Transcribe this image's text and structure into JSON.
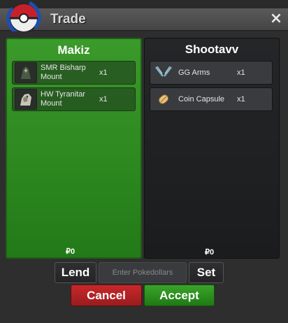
{
  "window": {
    "title": "Trade",
    "close_symbol": "×"
  },
  "icons": {
    "logo": "pokeball-logo-icon",
    "close": "close-icon"
  },
  "colors": {
    "left_panel": "#2e8a22",
    "accent_red": "#b22022",
    "accent_green": "#2a9a1e"
  },
  "left": {
    "player": "Makiz",
    "items": [
      {
        "name": "SMR Bisharp Mount",
        "qty": "x1",
        "icon": "bisharp-mount-icon"
      },
      {
        "name": "HW Tyranitar Mount",
        "qty": "x1",
        "icon": "tyranitar-mount-icon"
      }
    ],
    "money": "₽0"
  },
  "right": {
    "player": "Shootavv",
    "items": [
      {
        "name": "GG Arms",
        "qty": "x1",
        "icon": "gg-arms-icon"
      },
      {
        "name": "Coin Capsule",
        "qty": "x1",
        "icon": "coin-capsule-icon"
      }
    ],
    "money": "₽0"
  },
  "controls": {
    "lend": "Lend",
    "input_placeholder": "Enter Pokedollars",
    "set": "Set",
    "cancel": "Cancel",
    "accept": "Accept"
  }
}
